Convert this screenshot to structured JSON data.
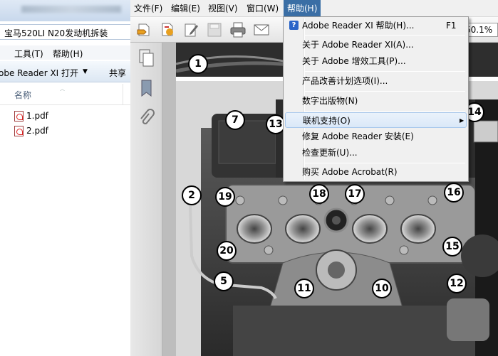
{
  "explorer": {
    "address": "宝马520LI  N20发动机拆装",
    "menu": {
      "tools": "工具(T)",
      "help": "帮助(H)"
    },
    "toolbar": {
      "open_with": "obe Reader XI 打开",
      "dropdown": "▼",
      "share": "共享"
    },
    "column_header": "名称",
    "files": [
      "1.pdf",
      "2.pdf"
    ]
  },
  "reader": {
    "menu": {
      "file": "文件(F)",
      "edit": "编辑(E)",
      "view": "视图(V)",
      "window": "窗口(W)",
      "help": "帮助(H)"
    },
    "zoom": "50.1%",
    "help_menu": [
      {
        "label": "Adobe Reader XI 帮助(H)...",
        "shortcut": "F1",
        "icon": "help-question-icon"
      },
      {
        "label": "关于 Adobe Reader XI(A)..."
      },
      {
        "label": "关于 Adobe 增效工具(P)..."
      },
      {
        "label": "产品改善计划选项(I)..."
      },
      {
        "label": "数字出版物(N)"
      },
      {
        "label": "联机支持(O)",
        "submenu": true
      },
      {
        "label": "修复 Adobe Reader 安装(E)"
      },
      {
        "label": "检查更新(U)..."
      },
      {
        "label": "购买 Adobe Acrobat(R)"
      }
    ],
    "callouts": [
      "1",
      "7",
      "13",
      "14",
      "2",
      "19",
      "18",
      "17",
      "16",
      "20",
      "15",
      "5",
      "11",
      "10",
      "12"
    ]
  },
  "colors": {
    "menu_active": "#3a6ea5",
    "menu_bg": "#f0f0f0",
    "hover_border": "#a8c8ec"
  }
}
